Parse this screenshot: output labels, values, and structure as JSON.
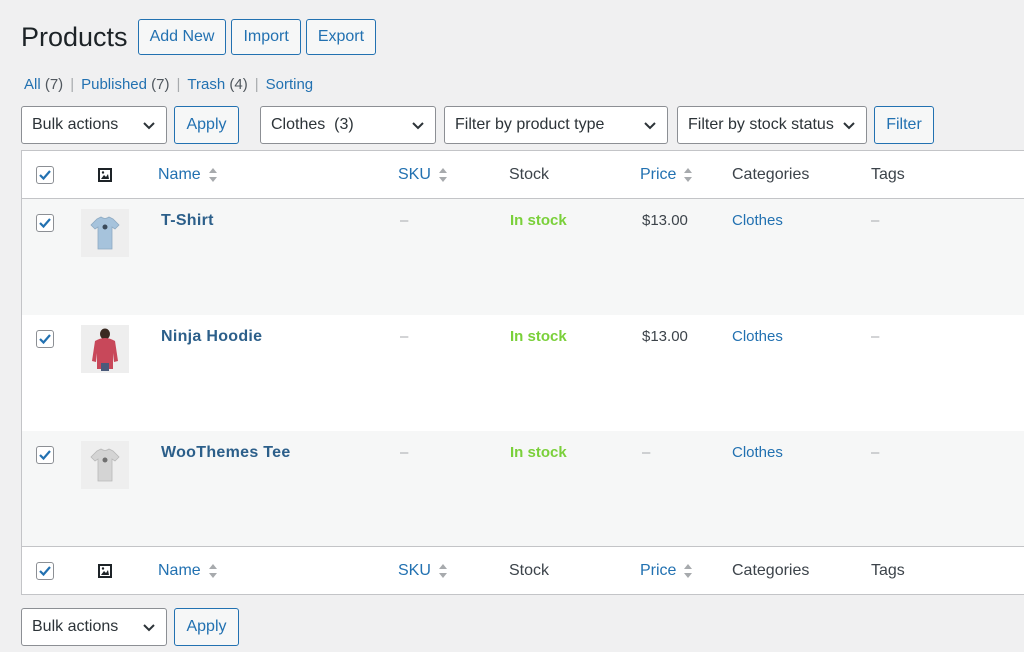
{
  "header": {
    "title": "Products",
    "buttons": [
      "Add New",
      "Import",
      "Export"
    ]
  },
  "views": [
    {
      "label": "All",
      "count": "(7)"
    },
    {
      "label": "Published",
      "count": "(7)"
    },
    {
      "label": "Trash",
      "count": "(4)"
    },
    {
      "label": "Sorting",
      "count": ""
    }
  ],
  "filters": {
    "bulk_actions": "Bulk actions",
    "apply": "Apply",
    "category": "Clothes  (3)",
    "product_type": "Filter by product type",
    "stock_status": "Filter by stock status",
    "filter": "Filter"
  },
  "columns": {
    "name": "Name",
    "sku": "SKU",
    "stock": "Stock",
    "price": "Price",
    "categories": "Categories",
    "tags": "Tags"
  },
  "rows": [
    {
      "name": "T-Shirt",
      "sku": "–",
      "stock": "In stock",
      "price": "$13.00",
      "category": "Clothes",
      "tags": "–",
      "thumb_icon": "t-shirt-blue-image"
    },
    {
      "name": "Ninja Hoodie",
      "sku": "–",
      "stock": "In stock",
      "price": "$13.00",
      "category": "Clothes",
      "tags": "–",
      "thumb_icon": "hoodie-red-image"
    },
    {
      "name": "WooThemes Tee",
      "sku": "–",
      "stock": "In stock",
      "price": "–",
      "category": "Clothes",
      "tags": "–",
      "thumb_icon": "t-shirt-grey-image"
    }
  ],
  "bottom": {
    "bulk_actions": "Bulk actions",
    "apply": "Apply"
  },
  "colors": {
    "accent": "#2271b1",
    "in_stock": "#7ad03a",
    "background": "#f0f0f1"
  }
}
